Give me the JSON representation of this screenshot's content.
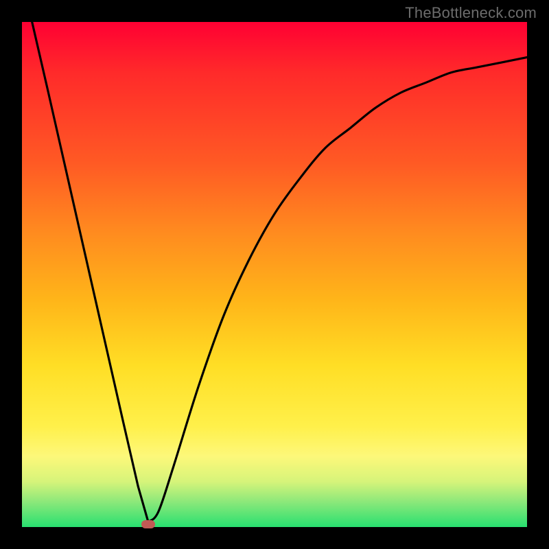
{
  "watermark": "TheBottleneck.com",
  "chart_data": {
    "type": "line",
    "title": "",
    "xlabel": "",
    "ylabel": "",
    "xlim": [
      0,
      100
    ],
    "ylim": [
      0,
      100
    ],
    "grid": false,
    "series": [
      {
        "name": "bottleneck-curve",
        "x": [
          2,
          5,
          10,
          15,
          20,
          23,
          25,
          27,
          30,
          35,
          40,
          45,
          50,
          55,
          60,
          65,
          70,
          75,
          80,
          85,
          90,
          95,
          100
        ],
        "values": [
          100,
          87,
          65,
          43,
          21,
          8,
          1,
          3,
          12,
          28,
          42,
          53,
          62,
          69,
          75,
          79,
          83,
          86,
          88,
          90,
          91,
          92,
          93
        ]
      }
    ],
    "annotations": [
      {
        "name": "optimal-marker",
        "x": 25,
        "y": 0.5
      }
    ],
    "background_gradient": {
      "top": "#ff0033",
      "mid": "#ffde25",
      "bottom": "#28e070"
    }
  }
}
